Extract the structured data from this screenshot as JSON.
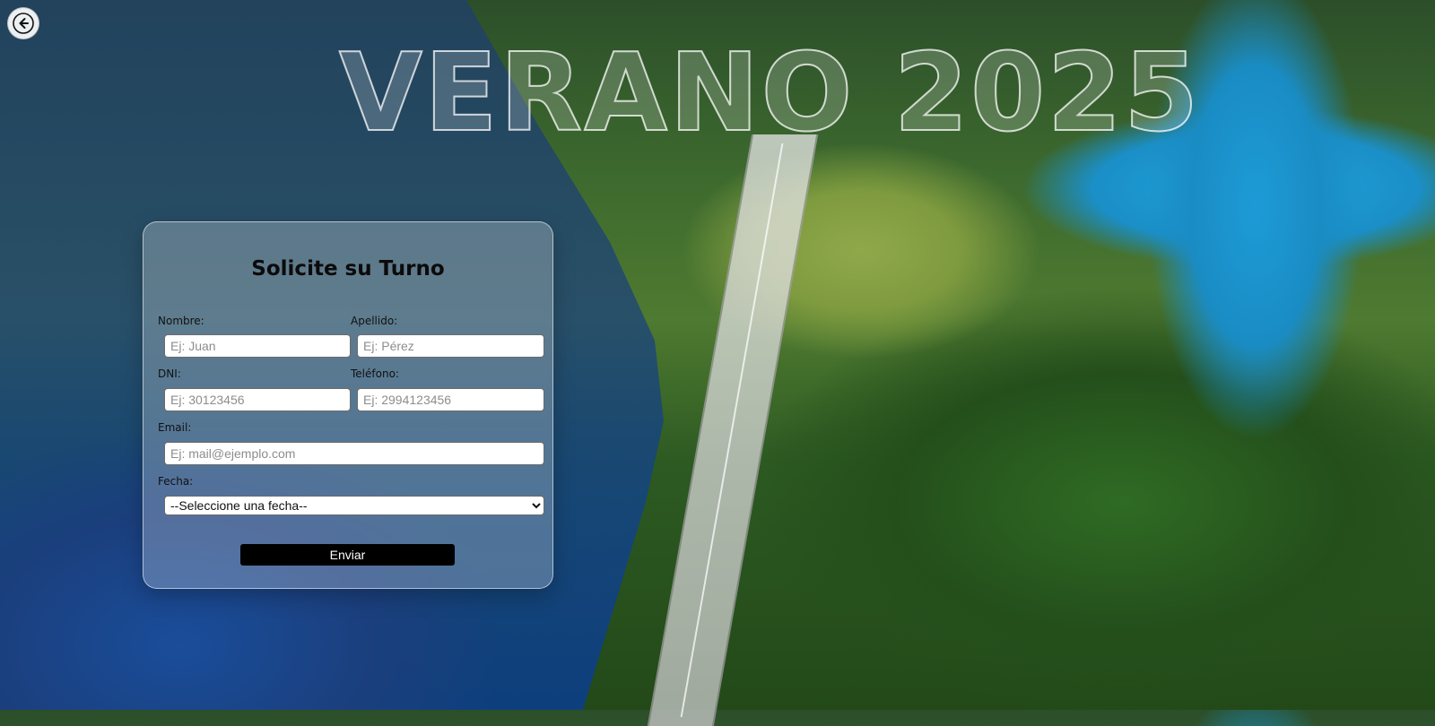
{
  "hero": {
    "title": "VERANO 2025"
  },
  "form": {
    "title": "Solicite su Turno",
    "fields": {
      "nombre": {
        "label": "Nombre:",
        "placeholder": "Ej: Juan"
      },
      "apellido": {
        "label": "Apellido:",
        "placeholder": "Ej: Pérez"
      },
      "dni": {
        "label": "DNI:",
        "placeholder": "Ej: 30123456"
      },
      "telefono": {
        "label": "Teléfono:",
        "placeholder": "Ej: 2994123456"
      },
      "email": {
        "label": "Email:",
        "placeholder": "Ej: mail@ejemplo.com"
      },
      "fecha": {
        "label": "Fecha:",
        "selected": "--Seleccione una fecha--"
      }
    },
    "submit_label": "Enviar"
  },
  "nav": {
    "back_icon": "arrow-left-icon"
  }
}
